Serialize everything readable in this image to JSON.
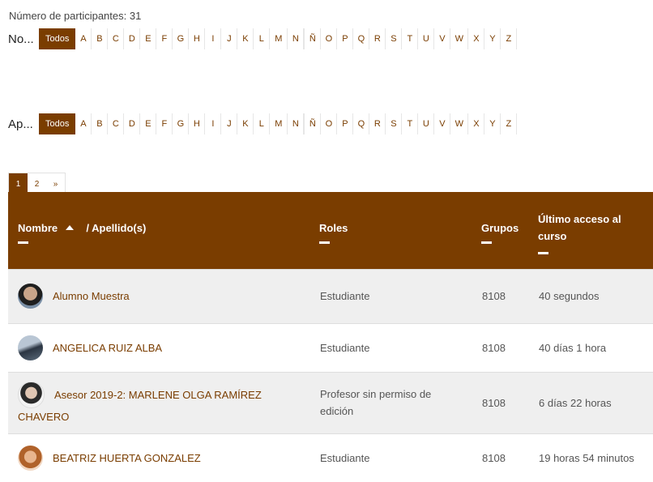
{
  "participants_count": "Número de participantes: 31",
  "filters": {
    "first_name_label": "No...",
    "last_name_label": "Ap...",
    "all_label": "Todos",
    "letters": [
      "A",
      "B",
      "C",
      "D",
      "E",
      "F",
      "G",
      "H",
      "I",
      "J",
      "K",
      "L",
      "M",
      "N",
      "Ñ",
      "O",
      "P",
      "Q",
      "R",
      "S",
      "T",
      "U",
      "V",
      "W",
      "X",
      "Y",
      "Z"
    ]
  },
  "pagination": {
    "pages": [
      "1",
      "2"
    ],
    "current": "1",
    "next": "»"
  },
  "table": {
    "headers": {
      "name": "Nombre",
      "surname": "/ Apellido(s)",
      "roles": "Roles",
      "groups": "Grupos",
      "last_access_line1": "Último acceso al",
      "last_access_line2": "curso"
    },
    "rows": [
      {
        "name": "Alumno Muestra",
        "role": "Estudiante",
        "group": "8108",
        "last_access": "40 segundos"
      },
      {
        "name": "ANGELICA RUIZ ALBA",
        "role": "Estudiante",
        "group": "8108",
        "last_access": "40 días 1 hora"
      },
      {
        "name_line1": "Asesor 2019-2: MARLENE OLGA RAMÍREZ",
        "name_line2": "CHAVERO",
        "role_line1": "Profesor sin permiso de",
        "role_line2": "edición",
        "group": "8108",
        "last_access": "6 días 22 horas"
      },
      {
        "name": "BEATRIZ HUERTA GONZALEZ",
        "role": "Estudiante",
        "group": "8108",
        "last_access": "19 horas 54 minutos"
      }
    ]
  },
  "colors": {
    "accent": "#7a3d00",
    "row_alt": "#efefef"
  },
  "icons": {
    "sort": "sort-asc-icon"
  }
}
